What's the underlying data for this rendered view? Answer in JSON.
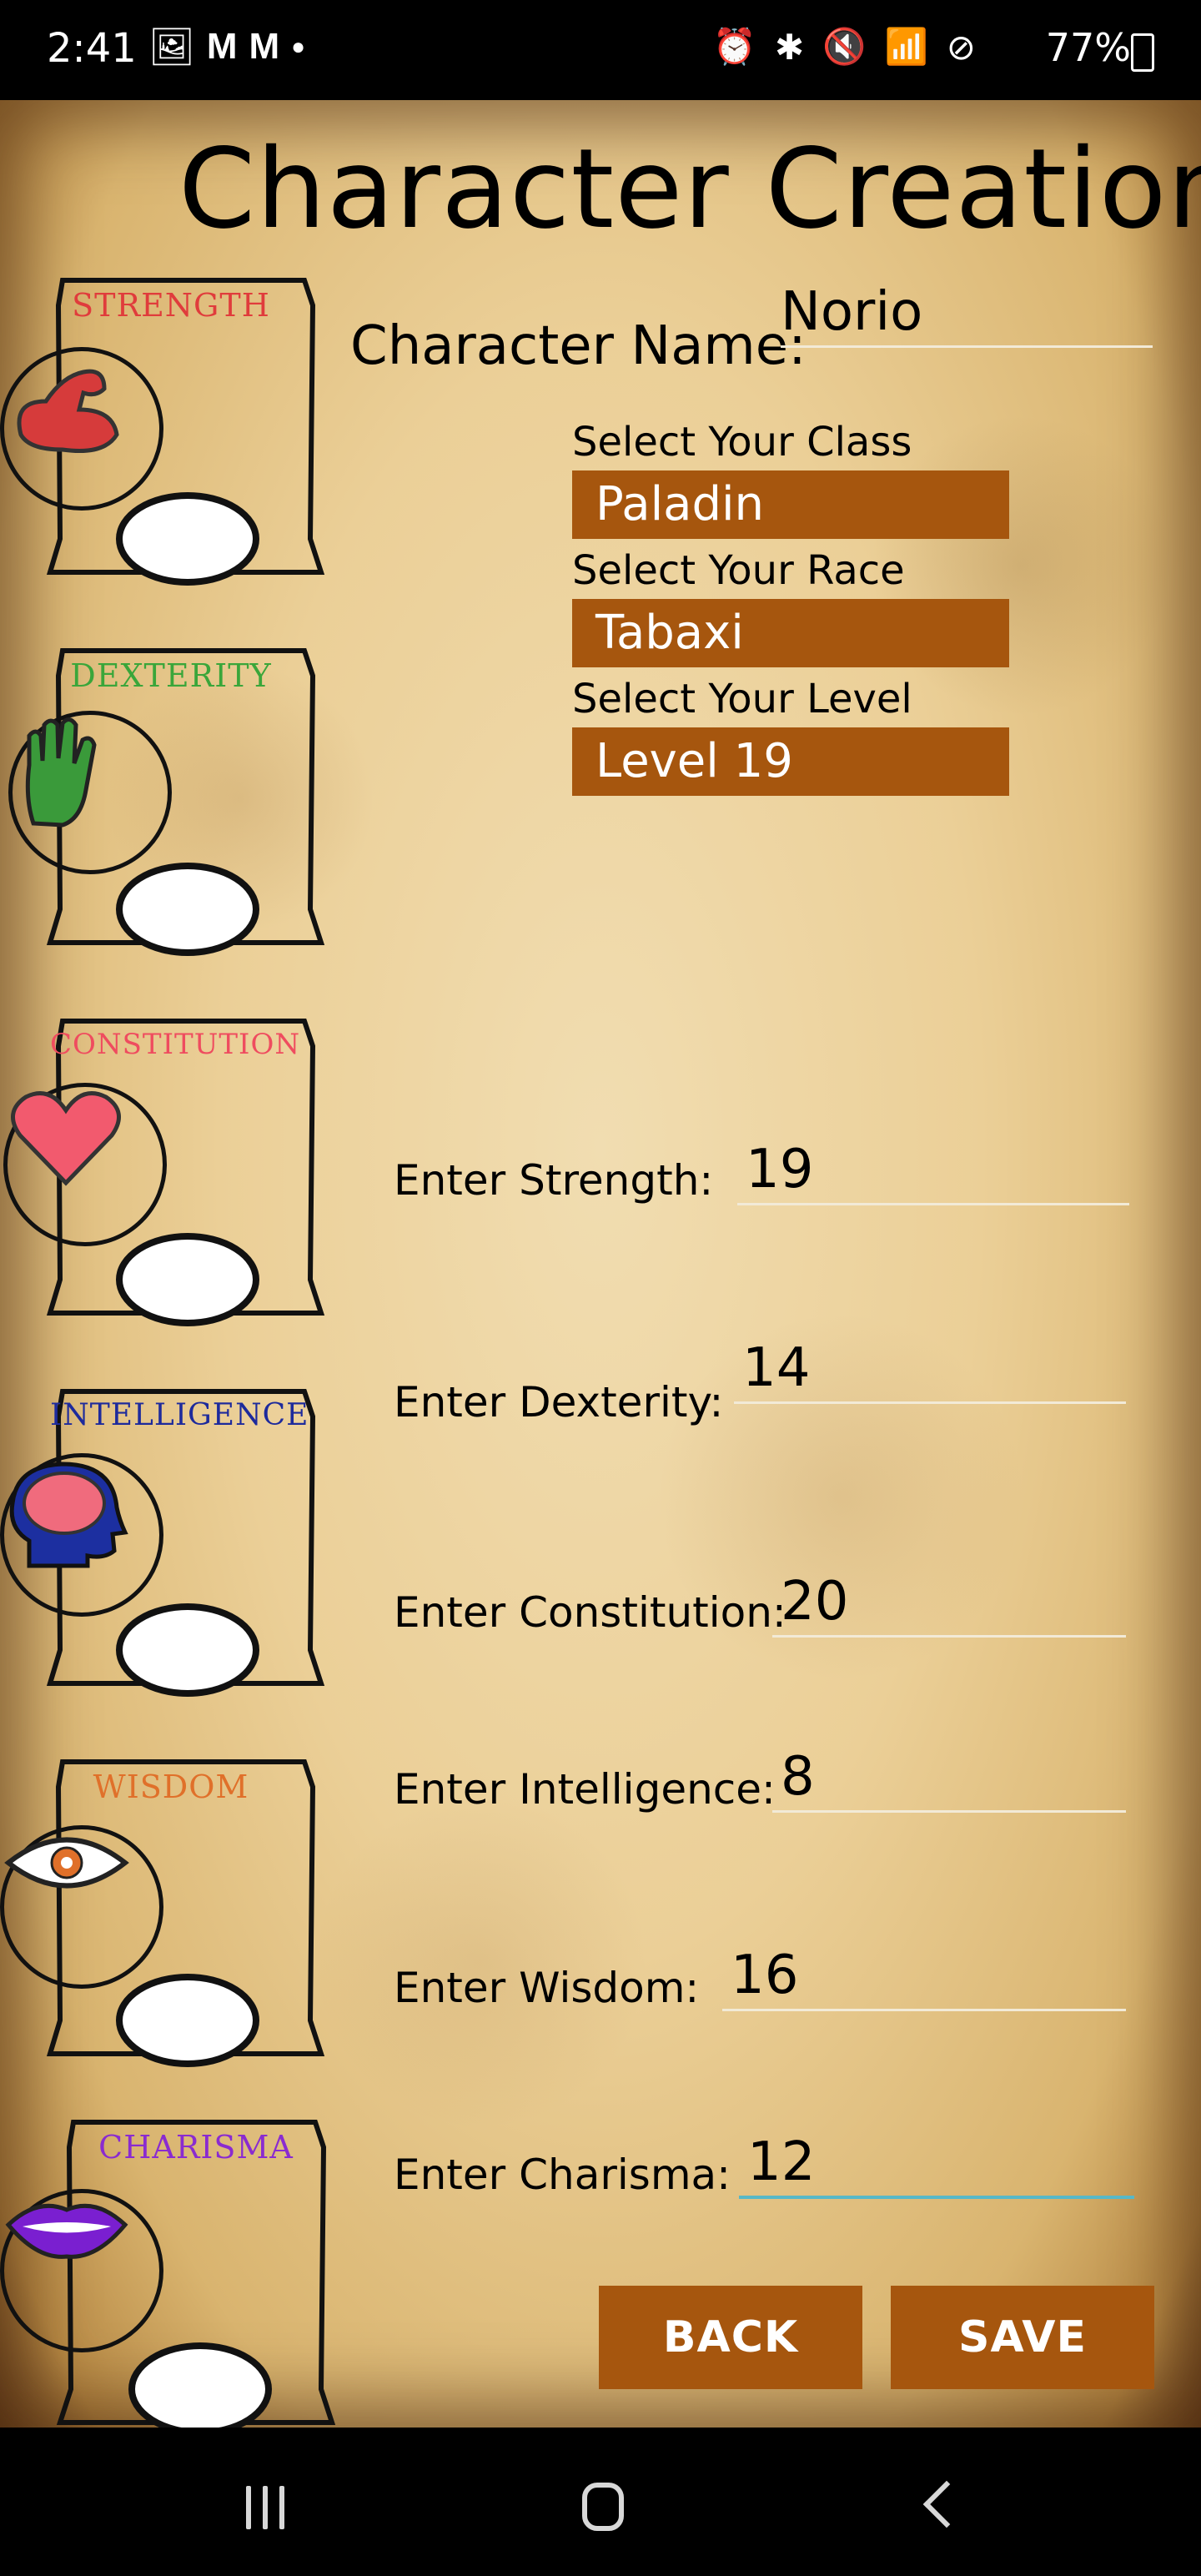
{
  "status_bar": {
    "time": "2:41",
    "battery": "77%",
    "left_icons": [
      "image-icon",
      "gmail-icon",
      "gmail-icon",
      "dot-icon"
    ],
    "right_icons": [
      "alarm-icon",
      "bluetooth-icon",
      "mute-icon",
      "wifi-icon",
      "do-not-disturb-icon"
    ]
  },
  "title": "Character Creation",
  "character": {
    "name_label": "Character Name:",
    "name_value": "Norio"
  },
  "selects": [
    {
      "label": "Select Your Class",
      "value": "Paladin"
    },
    {
      "label": "Select Your Race",
      "value": "Tabaxi"
    },
    {
      "label": "Select Your Level",
      "value": "Level 19"
    }
  ],
  "stats": [
    {
      "label": "Enter Strength:",
      "value": "19"
    },
    {
      "label": "Enter Dexterity:",
      "value": "14"
    },
    {
      "label": "Enter Constitution:",
      "value": "20"
    },
    {
      "label": "Enter Intelligence:",
      "value": "8"
    },
    {
      "label": "Enter Wisdom:",
      "value": "16"
    },
    {
      "label": "Enter Charisma:",
      "value": "12"
    }
  ],
  "cards": [
    {
      "title": "STRENGTH",
      "color": "#e03c3c",
      "icon": "flexed-arm-icon"
    },
    {
      "title": "DEXTERITY",
      "color": "#3aa63a",
      "icon": "hand-icon"
    },
    {
      "title": "CONSTITUTION",
      "color": "#ef4c5f",
      "icon": "heart-icon"
    },
    {
      "title": "INTELLIGENCE",
      "color": "#1d2a9c",
      "icon": "brain-icon"
    },
    {
      "title": "WISDOM",
      "color": "#e0702a",
      "icon": "eye-icon"
    },
    {
      "title": "CHARISMA",
      "color": "#8a2bd0",
      "icon": "lips-icon"
    }
  ],
  "buttons": {
    "back": "BACK",
    "save": "SAVE"
  },
  "colors": {
    "accent": "#a6560e",
    "active_underline": "#57b8c7"
  }
}
